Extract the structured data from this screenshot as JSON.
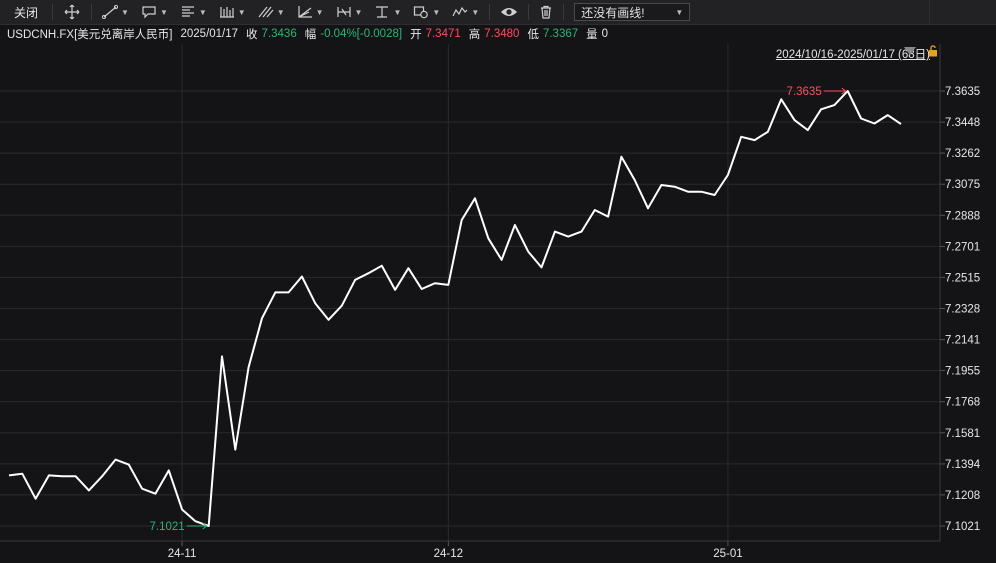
{
  "toolbar": {
    "close_label": "关闭",
    "drawing_select": "还没有画线!",
    "tools": [
      "move-icon",
      "line-tool-icon",
      "callout-tool-icon",
      "text-align-tool-icon",
      "bars-tool-icon",
      "parallel-lines-tool-icon",
      "fan-tool-icon",
      "pattern-tool-icon",
      "fib-tool-icon",
      "shape-tool-icon",
      "wave-tool-icon",
      "eye-icon",
      "trash-icon"
    ]
  },
  "info": {
    "symbol": "USDCNH.FX[美元兑离岸人民币]",
    "date": "2025/01/17",
    "close_label": "收",
    "close": "7.3436",
    "change_label": "幅",
    "change": "-0.04%[-0.0028]",
    "open_label": "开",
    "open": "7.3471",
    "high_label": "高",
    "high": "7.3480",
    "low_label": "低",
    "low": "7.3367",
    "volume_label": "量",
    "volume": "0"
  },
  "range_label": "2024/10/16-2025/01/17 (68日)",
  "colors": {
    "background": "#141416",
    "line": "#ffffff",
    "up": "#ff4d5c",
    "down": "#2fb37a",
    "grid": "#2a2a2e"
  },
  "chart_data": {
    "type": "line",
    "series": [
      {
        "values": [
          7.1325,
          7.1335,
          7.1185,
          7.1325,
          7.132,
          7.132,
          7.1235,
          7.132,
          7.142,
          7.139,
          7.1245,
          7.1215,
          7.1355,
          7.112,
          7.105,
          7.1021,
          7.204,
          7.148,
          7.1975,
          7.227,
          7.2425,
          7.2425,
          7.252,
          7.236,
          7.226,
          7.2345,
          7.25,
          7.254,
          7.2585,
          7.244,
          7.257,
          7.2445,
          7.248,
          7.247,
          7.286,
          7.299,
          7.275,
          7.262,
          7.283,
          7.267,
          7.2575,
          7.279,
          7.276,
          7.279,
          7.292,
          7.288,
          7.324,
          7.31,
          7.293,
          7.307,
          7.306,
          7.303,
          7.303,
          7.301,
          7.313,
          7.336,
          7.334,
          7.339,
          7.3585,
          7.346,
          7.34,
          7.3525,
          7.355,
          7.3635,
          7.347,
          7.344,
          7.349,
          7.3436
        ]
      }
    ],
    "x_ticks": [
      "24-11",
      "24-12",
      "25-01"
    ],
    "x_tick_index": [
      13.0,
      33.0,
      54.0
    ],
    "y_ticks": [
      "7.3635",
      "7.3448",
      "7.3262",
      "7.3075",
      "7.2888",
      "7.2701",
      "7.2515",
      "7.2328",
      "7.2141",
      "7.1955",
      "7.1768",
      "7.1581",
      "7.1394",
      "7.1208",
      "7.1021"
    ],
    "ylim": [
      7.1021,
      7.3635
    ],
    "max_annotation": "7.3635",
    "min_annotation": "7.1021",
    "grid": true,
    "y_axis_side": "right"
  }
}
